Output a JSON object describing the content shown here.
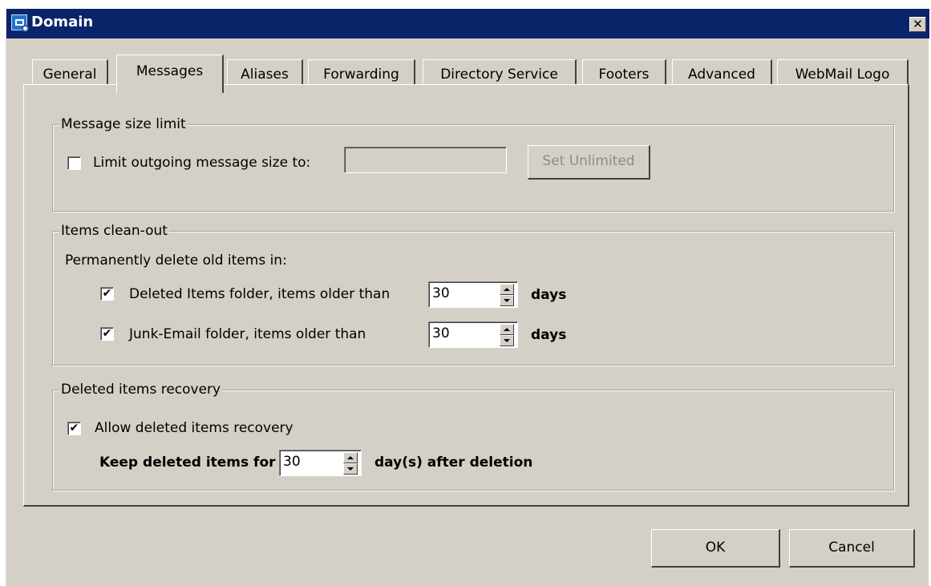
{
  "window": {
    "title": "Domain",
    "close_label": "✕"
  },
  "tabs": [
    {
      "label": "General",
      "active": false
    },
    {
      "label": "Messages",
      "active": true
    },
    {
      "label": "Aliases",
      "active": false
    },
    {
      "label": "Forwarding",
      "active": false
    },
    {
      "label": "Directory Service",
      "active": false
    },
    {
      "label": "Footers",
      "active": false
    },
    {
      "label": "Advanced",
      "active": false
    },
    {
      "label": "WebMail Logo",
      "active": false
    }
  ],
  "size_limit": {
    "legend": "Message size limit",
    "checkbox_label": "Limit outgoing message size to:",
    "checked": false,
    "value": "",
    "set_unlimited_label": "Set Unlimited"
  },
  "cleanout": {
    "legend": "Items clean-out",
    "intro": "Permanently delete old items in:",
    "deleted_items": {
      "label": "Deleted Items folder, items older than",
      "checked": true,
      "value": "30",
      "unit": "days"
    },
    "junk_email": {
      "label": "Junk-Email folder, items older than",
      "checked": true,
      "value": "30",
      "unit": "days"
    }
  },
  "recovery": {
    "legend": "Deleted items recovery",
    "allow_label": "Allow deleted items recovery",
    "allow_checked": true,
    "keep_label": "Keep deleted items for",
    "keep_value": "30",
    "keep_suffix": "day(s) after deletion"
  },
  "footer": {
    "ok_label": "OK",
    "cancel_label": "Cancel"
  },
  "check_glyph": "✔"
}
